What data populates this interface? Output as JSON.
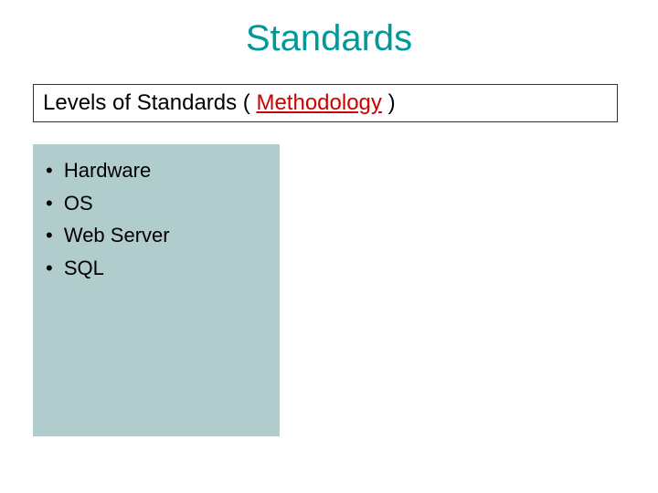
{
  "title": "Standards",
  "subtitle": {
    "prefix": "Levels of Standards ( ",
    "emph": "Methodology",
    "suffix": " )"
  },
  "bullets": [
    "Hardware",
    "OS",
    "Web Server",
    "SQL"
  ]
}
